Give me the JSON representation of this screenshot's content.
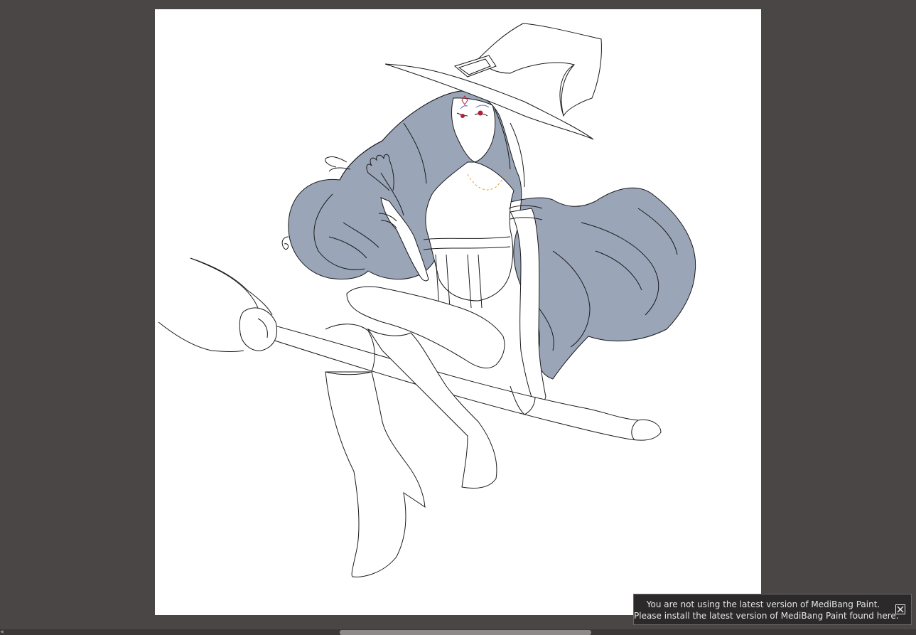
{
  "app": {
    "name": "MediBang Paint"
  },
  "notice": {
    "line1": "You are not using the latest version of MediBang Paint.",
    "line2": "Please install the latest version of MediBang Paint found here.",
    "close_icon": "close-box-icon"
  },
  "canvas": {
    "background": "#ffffff",
    "hair_fill": "#9aa5b8",
    "line_color": "#1a1a1a"
  },
  "colors": {
    "workspace": "#4a4645",
    "scrollbar_thumb": "#8d8a89"
  }
}
